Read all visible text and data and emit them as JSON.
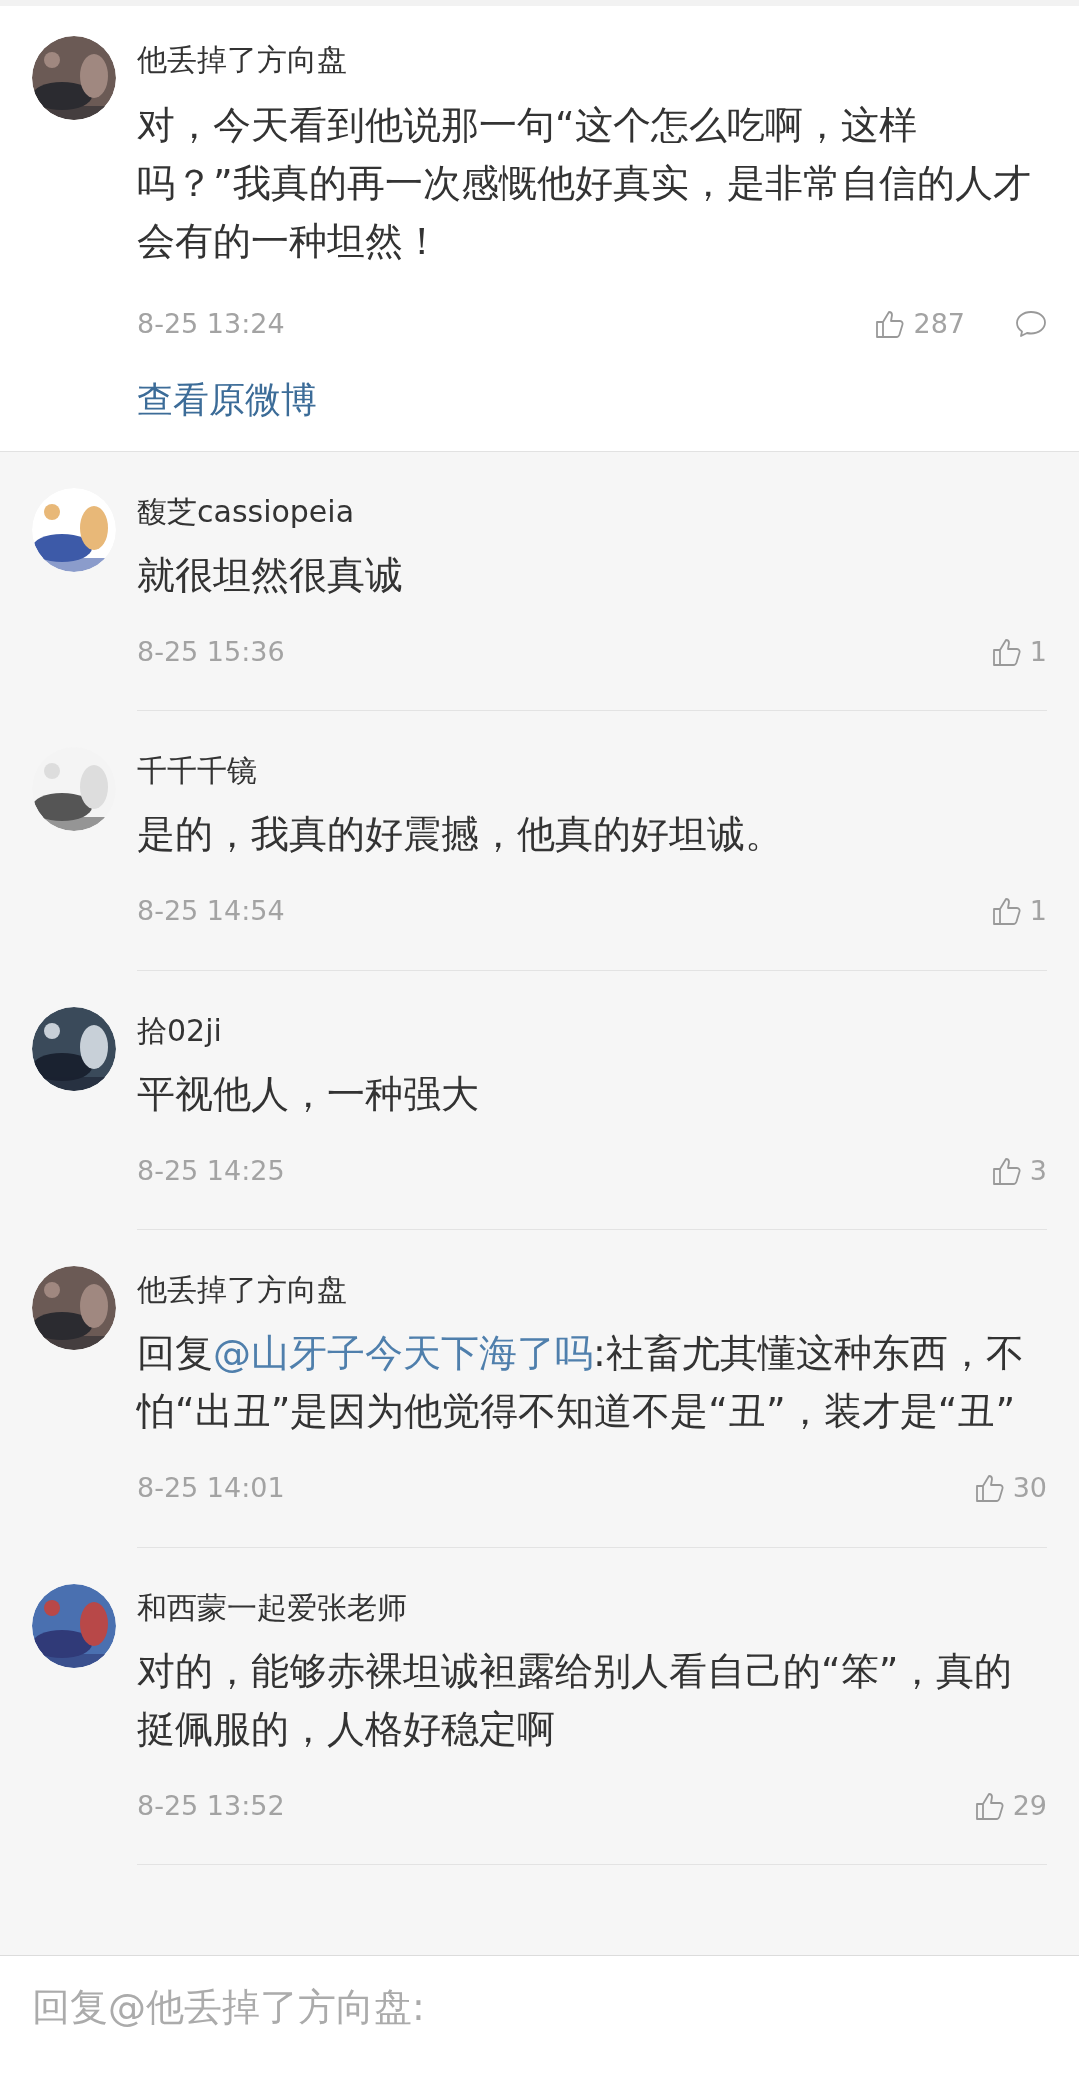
{
  "main_comment": {
    "author": "他丢掉了方向盘",
    "text": "对，今天看到他说那一句“这个怎么吃啊，这样吗？”我真的再一次感慨他好真实，是非常自信的人才会有的一种坦然！",
    "time": "8-25 13:24",
    "likes": "287",
    "view_original": "查看原微博"
  },
  "replies": [
    {
      "author": "馥芝cassiopeia",
      "body": [
        {
          "kind": "text",
          "text": "就很坦然很真诚"
        }
      ],
      "time": "8-25 15:36",
      "likes": "1"
    },
    {
      "author": "千千千镜",
      "body": [
        {
          "kind": "text",
          "text": "是的，我真的好震撼，他真的好坦诚。"
        }
      ],
      "time": "8-25 14:54",
      "likes": "1"
    },
    {
      "author": "拾02ji",
      "body": [
        {
          "kind": "text",
          "text": "平视他人，一种强大"
        }
      ],
      "time": "8-25 14:25",
      "likes": "3"
    },
    {
      "author": "他丢掉了方向盘",
      "body": [
        {
          "kind": "text",
          "text": "回复"
        },
        {
          "kind": "mention",
          "text": "@山牙子今天下海了吗"
        },
        {
          "kind": "text",
          "text": ":社畜尤其懂这种东西，不怕“出丑”是因为他觉得不知道不是“丑”，装才是“丑”"
        }
      ],
      "time": "8-25 14:01",
      "likes": "30"
    },
    {
      "author": "和西蒙一起爱张老师",
      "body": [
        {
          "kind": "text",
          "text": "对的，能够赤裸坦诚袒露给别人看自己的“笨”，真的挺佩服的，人格好稳定啊"
        }
      ],
      "time": "8-25 13:52",
      "likes": "29"
    }
  ],
  "reply_box": {
    "placeholder": "回复@他丢掉了方向盘:"
  }
}
